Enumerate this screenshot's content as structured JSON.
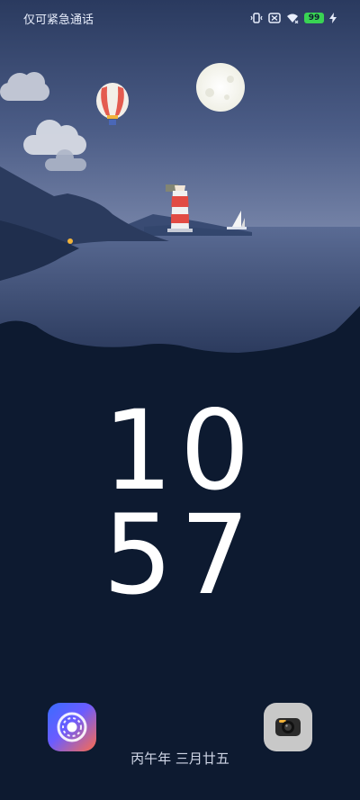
{
  "statusbar": {
    "carrier_text": "仅可紧急通话",
    "battery_level": "99"
  },
  "lockscreen": {
    "hours": "10",
    "minutes": "57",
    "lunar_date": "丙午年 三月廿五"
  },
  "shortcuts": {
    "left": "settings-ring-app",
    "right": "camera-app"
  },
  "colors": {
    "sky_top": "#2e3f63",
    "sky_bottom": "#5f6f98",
    "sea": "#3d4f77",
    "ground": "#0d1a30",
    "accent_battery": "#39d353"
  }
}
